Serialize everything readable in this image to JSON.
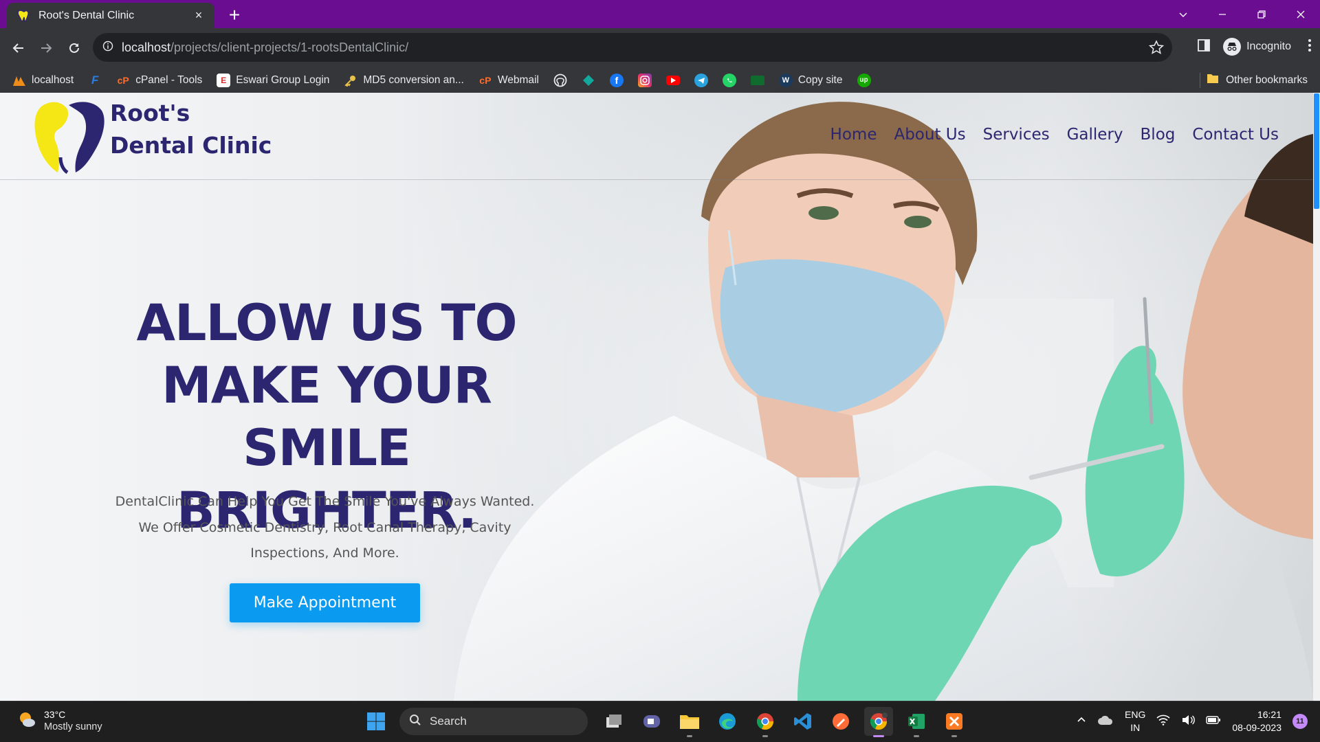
{
  "browser": {
    "tab": {
      "title": "Root's Dental Clinic",
      "close": "×"
    },
    "new_tab": "+",
    "address": {
      "host": "localhost",
      "path": "/projects/client-projects/1-rootsDentalClinic/"
    },
    "profile_label": "Incognito",
    "bookmarks": [
      {
        "label": "localhost",
        "icon": "xampp-icon"
      },
      {
        "label": "",
        "icon": "f-logo-icon"
      },
      {
        "label": "cPanel - Tools",
        "icon": "cpanel-icon"
      },
      {
        "label": "Eswari Group Login",
        "icon": "eswari-icon"
      },
      {
        "label": "MD5 conversion an...",
        "icon": "key-icon"
      },
      {
        "label": "Webmail",
        "icon": "cpanel-icon"
      },
      {
        "label": "",
        "icon": "github-icon"
      },
      {
        "label": "",
        "icon": "diamond-icon"
      },
      {
        "label": "",
        "icon": "facebook-icon"
      },
      {
        "label": "",
        "icon": "instagram-icon"
      },
      {
        "label": "",
        "icon": "youtube-icon"
      },
      {
        "label": "",
        "icon": "telegram-icon"
      },
      {
        "label": "",
        "icon": "whatsapp-icon"
      },
      {
        "label": "",
        "icon": "sheet-icon"
      },
      {
        "label": "Copy site",
        "icon": "w-icon"
      },
      {
        "label": "",
        "icon": "upwork-icon"
      }
    ],
    "other_bookmarks": "Other bookmarks"
  },
  "site": {
    "brand_line1": "Root's",
    "brand_line2": "Dental Clinic",
    "nav": [
      "Home",
      "About Us",
      "Services",
      "Gallery",
      "Blog",
      "Contact Us"
    ],
    "hero": {
      "title_line1": "ALLOW US TO",
      "title_line2": "MAKE YOUR",
      "title_line3": "SMILE BRIGHTER.",
      "subtitle": "DentalClinic Can Help You Get The Smile You've Always Wanted. We Offer Cosmetic Dentistry, Root Canal Therapy, Cavity Inspections, And More.",
      "cta": "Make Appointment"
    },
    "colors": {
      "brand": "#2c2670",
      "accent": "#0a9bf0",
      "logo_yellow": "#f5e616"
    }
  },
  "taskbar": {
    "weather": {
      "temp": "33°C",
      "desc": "Mostly sunny"
    },
    "search_label": "Search",
    "apps": [
      "task-view-icon",
      "teams-icon",
      "file-explorer-icon",
      "edge-icon",
      "chrome-icon",
      "vscode-icon",
      "postman-icon",
      "chrome-incognito-icon",
      "excel-icon",
      "xampp-icon"
    ],
    "lang_line1": "ENG",
    "lang_line2": "IN",
    "time": "16:21",
    "date": "08-09-2023",
    "notifications": "11"
  }
}
